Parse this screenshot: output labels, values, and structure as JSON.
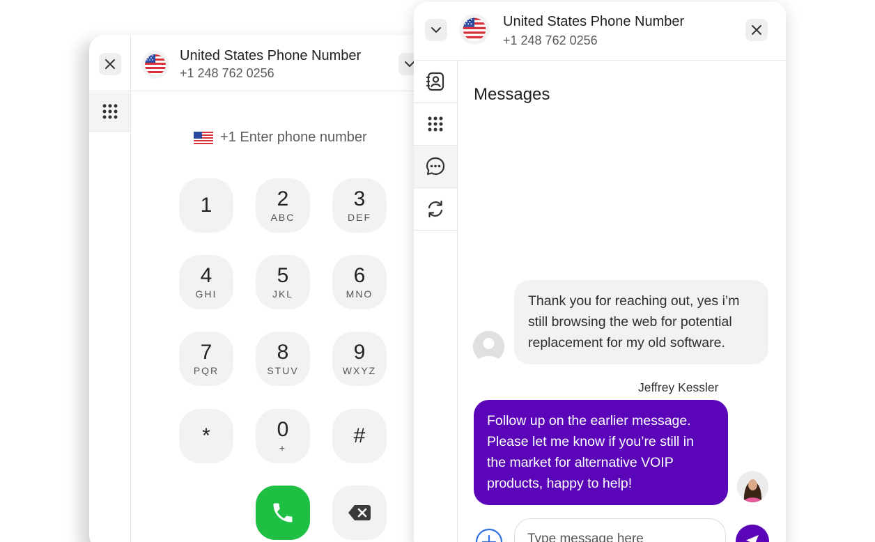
{
  "dialer": {
    "title": "United States Phone Number",
    "number": "+1 248 762 0256",
    "phone_input_placeholder": "+1 Enter phone number",
    "keys": [
      {
        "digit": "1",
        "letters": ""
      },
      {
        "digit": "2",
        "letters": "ABC"
      },
      {
        "digit": "3",
        "letters": "DEF"
      },
      {
        "digit": "4",
        "letters": "GHI"
      },
      {
        "digit": "5",
        "letters": "JKL"
      },
      {
        "digit": "6",
        "letters": "MNO"
      },
      {
        "digit": "7",
        "letters": "PQR"
      },
      {
        "digit": "8",
        "letters": "STUV"
      },
      {
        "digit": "9",
        "letters": "WXYZ"
      },
      {
        "digit": "*",
        "letters": ""
      },
      {
        "digit": "0",
        "letters": "+"
      },
      {
        "digit": "#",
        "letters": ""
      }
    ],
    "icons": {
      "close": "close-icon",
      "chevron": "chevron-down-icon",
      "keypad": "keypad-grid-icon",
      "call": "phone-icon",
      "backspace": "backspace-icon"
    }
  },
  "messenger": {
    "title": "United States Phone Number",
    "number": "+1 248 762 0256",
    "heading": "Messages",
    "rail": [
      "contacts-icon",
      "keypad-grid-icon",
      "chat-bubble-icon",
      "refresh-icon"
    ],
    "messages": [
      {
        "direction": "incoming",
        "text": "Thank you for reaching out, yes i’m still browsing the web for potential replacement for my old software."
      },
      {
        "direction": "outgoing",
        "sender": "Jeffrey Kessler",
        "text": "Follow up on the earlier message. Please let me know if you’re still in the market for alternative VOIP products, happy to help!"
      }
    ],
    "composer": {
      "placeholder": "Type message here"
    }
  },
  "colors": {
    "accent_purple": "#5a06b8",
    "call_green": "#1ebf43",
    "key_bg": "#f2f2f4",
    "bubble_gray": "#f2f2f4"
  }
}
